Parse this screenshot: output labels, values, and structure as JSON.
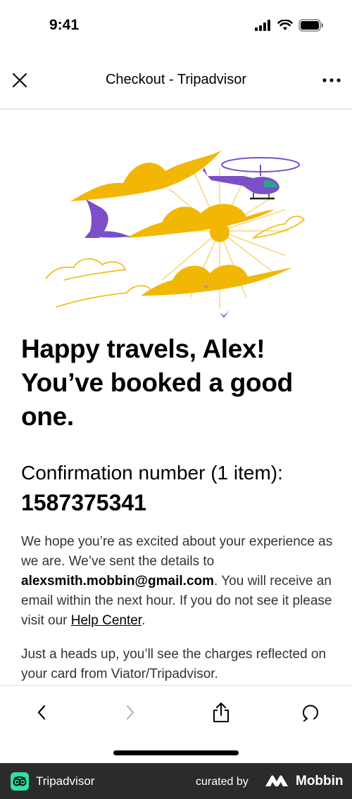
{
  "status_bar": {
    "time": "9:41"
  },
  "header": {
    "title": "Checkout - Tripadvisor"
  },
  "main": {
    "headline_lines": [
      "Happy travels, Alex!",
      "You’ve booked a good",
      "one."
    ],
    "confirmation_label": "Confirmation number (1 item):",
    "confirmation_number": "1587375341",
    "body_part1": "We hope you’re as excited about your experience as we are. We’ve sent the details to ",
    "email": "alexsmith.mobbin@gmail.com",
    "body_part2": ". You will receive an email within the next hour. If you do not see it please visit our ",
    "help_link": "Help Center",
    "body_part3": ".",
    "heads_up": "Just a heads up, you’ll see the charges reflected on your card from Viator/Tripadvisor."
  },
  "footer": {
    "brand": "Tripadvisor",
    "curated_by": "curated by",
    "mobbin": "Mobbin"
  },
  "colors": {
    "accent_yellow": "#f2b705",
    "accent_purple": "#7b4fc9",
    "tripadvisor_green": "#34e0a1",
    "footer_bg": "#2b2b2b"
  },
  "icons": {
    "close": "close-icon",
    "more": "more-icon",
    "back": "chevron-left-icon",
    "forward": "chevron-right-icon",
    "share": "share-icon",
    "reload": "reload-icon"
  }
}
